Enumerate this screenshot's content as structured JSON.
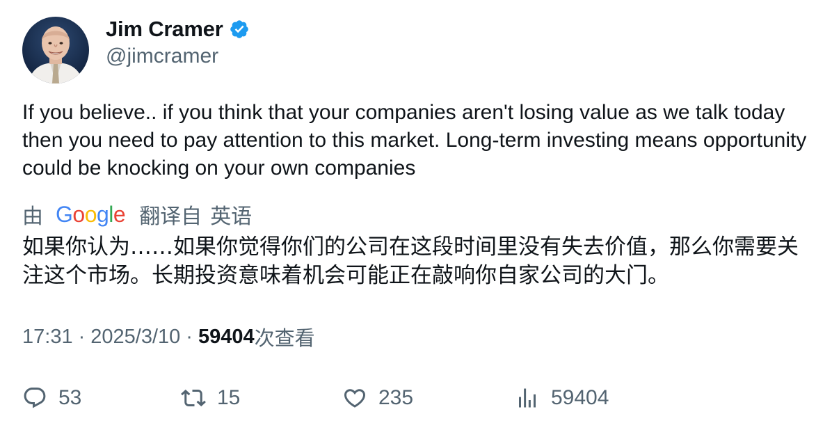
{
  "author": {
    "display_name": "Jim Cramer",
    "handle": "@jimcramer",
    "verified": true,
    "avatar_icon": "person-portrait-avatar"
  },
  "tweet": {
    "text": "If you believe.. if you think that your companies aren't losing value as we talk today then you need to pay attention to this market. Long-term investing means opportunity could be knocking on your own companies"
  },
  "translation": {
    "prefix": "由",
    "provider_logo_text": "Google",
    "translated_from": "翻译自",
    "language_link": "英语",
    "text": "如果你认为……如果你觉得你们的公司在这段时间里没有失去价值，那么你需要关注这个市场。长期投资意味着机会可能正在敲响你自家公司的大门。"
  },
  "meta": {
    "time": "17:31",
    "separator": "·",
    "date": "2025/3/10",
    "views_count": "59404",
    "views_label": "次查看"
  },
  "actions": {
    "reply": {
      "icon": "reply-icon",
      "count": "53"
    },
    "retweet": {
      "icon": "retweet-icon",
      "count": "15"
    },
    "like": {
      "icon": "heart-icon",
      "count": "235"
    },
    "views": {
      "icon": "analytics-icon",
      "count": "59404"
    }
  },
  "colors": {
    "text_primary": "#0f1419",
    "text_secondary": "#536471",
    "verified_blue": "#1d9bf0",
    "background": "#ffffff"
  }
}
